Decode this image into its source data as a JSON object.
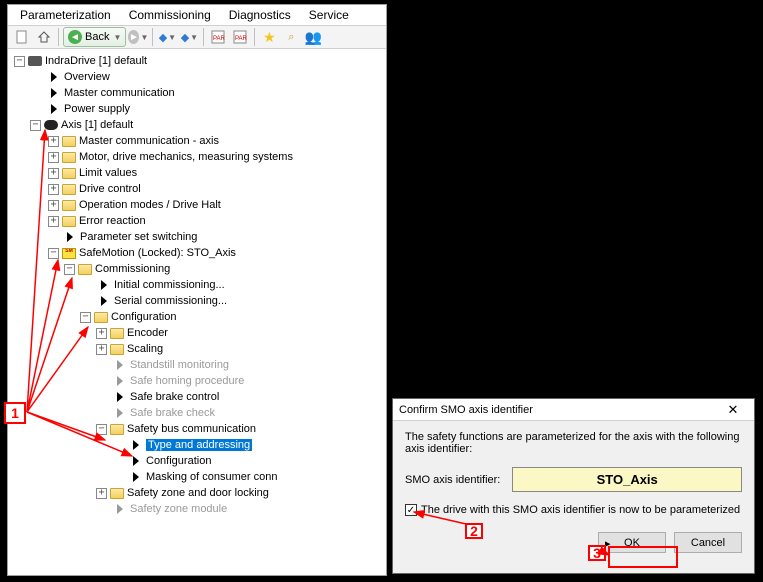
{
  "menubar": {
    "items": [
      "Parameterization",
      "Commissioning",
      "Diagnostics",
      "Service"
    ]
  },
  "toolbar": {
    "back_label": "Back"
  },
  "tree": {
    "root": {
      "label": "IndraDrive [1] default"
    },
    "root_children": [
      "Overview",
      "Master communication",
      "Power supply"
    ],
    "axis": {
      "label": "Axis [1] default"
    },
    "axis_children": [
      "Master communication - axis",
      "Motor, drive mechanics, measuring systems",
      "Limit values",
      "Drive control",
      "Operation modes / Drive Halt",
      "Error reaction",
      "Parameter set switching"
    ],
    "safemotion": {
      "label": "SafeMotion (Locked): STO_Axis"
    },
    "commissioning": {
      "label": "Commissioning",
      "items": [
        "Initial commissioning...",
        "Serial commissioning..."
      ]
    },
    "configuration": {
      "label": "Configuration"
    },
    "config_children": {
      "encoder": "Encoder",
      "scaling": "Scaling",
      "standstill": "Standstill monitoring",
      "homing": "Safe homing procedure",
      "brake_ctrl": "Safe brake control",
      "brake_chk": "Safe brake check"
    },
    "safety_bus": {
      "label": "Safety bus communication",
      "type_addr": "Type and addressing",
      "config": "Configuration",
      "masking": "Masking of consumer conn"
    },
    "zone_lock": "Safety zone and door locking",
    "zone_mod": "Safety zone module"
  },
  "dialog": {
    "title": "Confirm SMO axis identifier",
    "intro": "The safety functions are parameterized for the axis with the following axis identifier:",
    "field_label": "SMO axis identifier:",
    "axis_id": "STO_Axis",
    "check_label": "The drive with this SMO axis identifier is now to be parameterized",
    "ok": "OK",
    "cancel": "Cancel"
  },
  "callouts": {
    "c1": "1",
    "c2": "2",
    "c3": "3"
  }
}
